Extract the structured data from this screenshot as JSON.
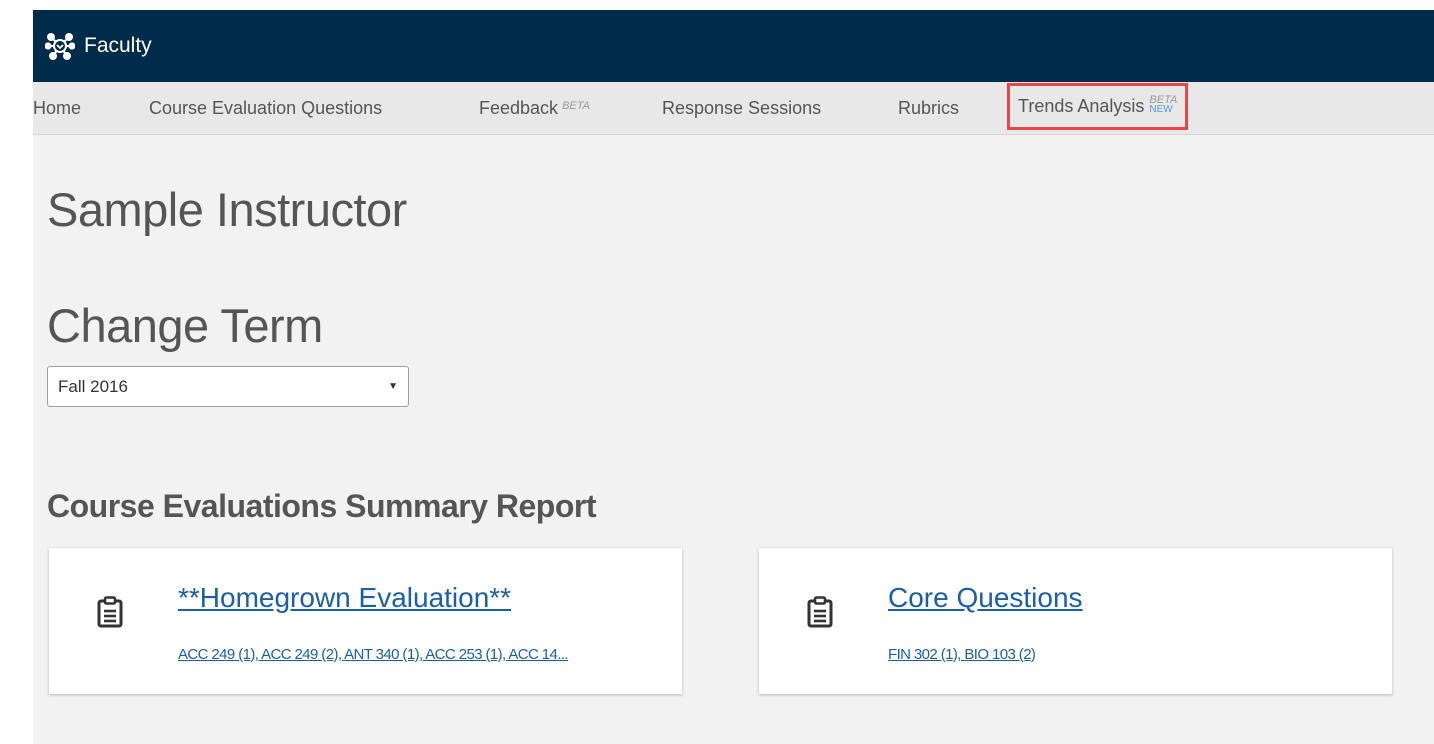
{
  "header": {
    "app_name": "Faculty",
    "logo_icon": "network-nodes-icon",
    "background_color": "#002b4a"
  },
  "nav": {
    "items": [
      {
        "label": "Home"
      },
      {
        "label": "Course Evaluation Questions"
      },
      {
        "label": "Feedback",
        "badge": "BETA"
      },
      {
        "label": "Response Sessions"
      },
      {
        "label": "Rubrics"
      },
      {
        "label": "Trends Analysis",
        "badge": "BETA",
        "badge2": "NEW",
        "highlighted": true
      }
    ],
    "highlight_color": "#e5474b"
  },
  "main": {
    "instructor_name": "Sample Instructor",
    "change_term_heading": "Change Term",
    "term_select": {
      "value": "Fall 2016"
    },
    "summary_heading": "Course Evaluations Summary Report",
    "cards": [
      {
        "icon": "clipboard-icon",
        "title": "**Homegrown Evaluation**",
        "courses": "ACC 249 (1), ACC 249 (2), ANT 340 (1), ACC 253 (1), ACC 14..."
      },
      {
        "icon": "clipboard-icon",
        "title": "Core Questions",
        "courses": "FIN 302 (1), BIO 103 (2)"
      }
    ],
    "link_color": "#1a5fa8"
  }
}
